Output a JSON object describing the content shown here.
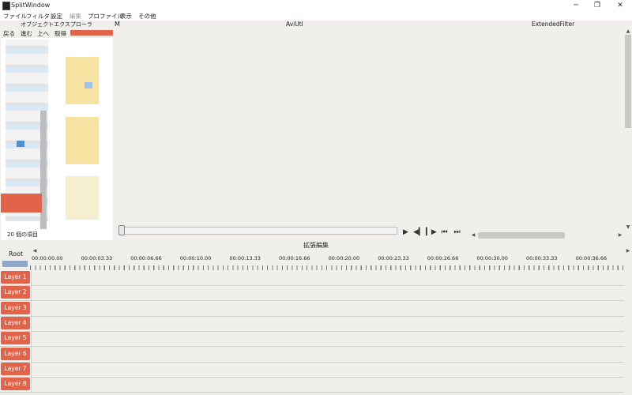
{
  "window": {
    "title": "SplitWindow",
    "controls": [
      "─",
      "❐",
      "✕"
    ]
  },
  "menubar": {
    "items": [
      "ファイル",
      "フィルタ",
      "設定",
      "編集",
      "プロファイル",
      "表示",
      "その他"
    ]
  },
  "explorer": {
    "title": "オブジェクトエクスプローラ",
    "toolbar": [
      "戻る",
      "進む",
      "上へ",
      "取得"
    ],
    "item_count": "20 個の項目"
  },
  "panes": {
    "m_label": "M",
    "aviutl_label": "AviUtl",
    "extended_filter_label": "ExtendedFilter"
  },
  "playback": {
    "buttons": [
      "▶",
      "◀▎",
      "▎▶",
      "⏮",
      "⏭"
    ]
  },
  "timeline": {
    "title": "拡張編集",
    "root_label": "Root",
    "ticks": [
      "00:00:00.00",
      "00:00:03.33",
      "00:00:06.66",
      "00:00:10.00",
      "00:00:13.33",
      "00:00:16.66",
      "00:00:20.00",
      "00:00:23.33",
      "00:00:26.66",
      "00:00:30.00",
      "00:00:33.33",
      "00:00:36.66"
    ],
    "layers": [
      "Layer 1",
      "Layer 2",
      "Layer 3",
      "Layer 4",
      "Layer 5",
      "Layer 6",
      "Layer 7",
      "Layer 8"
    ]
  },
  "colors": {
    "accent": "#e0634a",
    "background": "#f0efec"
  }
}
